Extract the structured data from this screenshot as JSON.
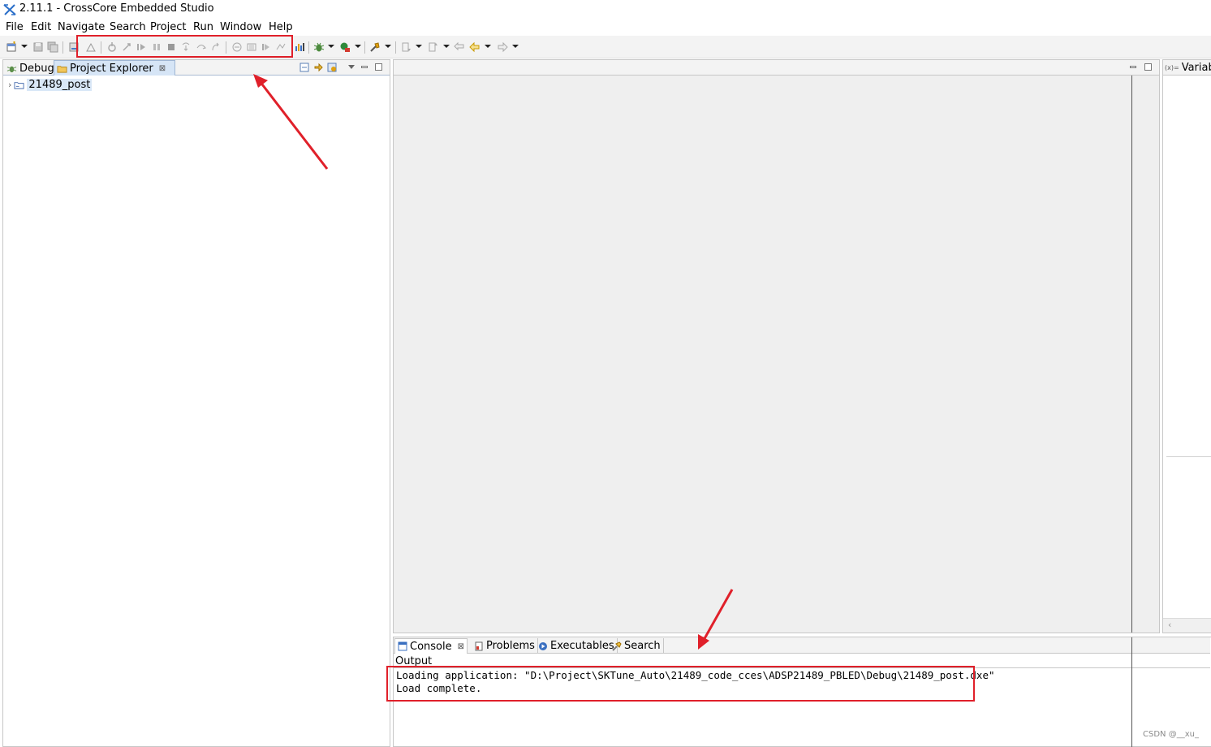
{
  "window": {
    "title": "2.11.1 - CrossCore Embedded Studio"
  },
  "menu": [
    "File",
    "Edit",
    "Navigate",
    "Search",
    "Project",
    "Run",
    "Window",
    "Help"
  ],
  "left_panel": {
    "tabs": [
      {
        "label": "Debug",
        "icon": "debug-bug-icon"
      },
      {
        "label": "Project Explorer",
        "icon": "project-folder-icon",
        "active": true
      }
    ],
    "tree": [
      {
        "label": "21489_post",
        "expanded": false
      }
    ]
  },
  "right_panel": {
    "tab_label": "Variabl"
  },
  "console": {
    "tabs": [
      {
        "label": "Console",
        "icon": "console-icon",
        "active": true
      },
      {
        "label": "Problems",
        "icon": "problems-icon"
      },
      {
        "label": "Executables",
        "icon": "executables-icon"
      },
      {
        "label": "Search",
        "icon": "search-flashlight-icon"
      }
    ],
    "output_label": "Output",
    "lines": [
      "Loading application: \"D:\\Project\\SKTune_Auto\\21489_code_cces\\ADSP21489_PBLED\\Debug\\21489_post.dxe\"",
      "Load complete."
    ]
  },
  "colors": {
    "annotation_red": "#e0202a",
    "selection_blue": "#d6e5f6"
  },
  "watermark": "CSDN @__xu_"
}
